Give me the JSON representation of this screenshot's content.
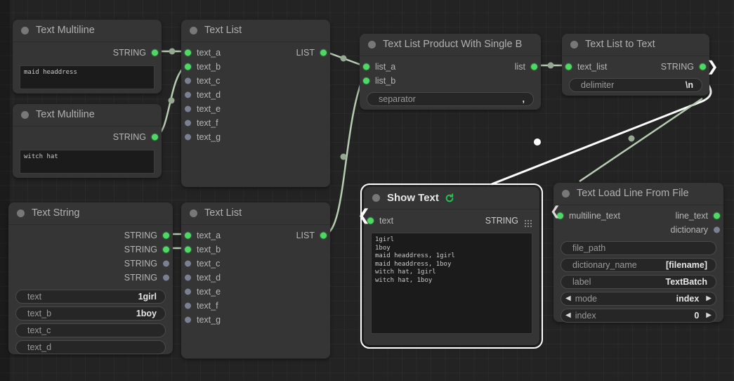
{
  "canvas": {
    "bg_color": "#232323",
    "grid_color": "#2b2b2b"
  },
  "colors": {
    "link_green": "#b8ccb4",
    "link_selected": "#ffffff",
    "slot_connected": "#4cd964",
    "slot_empty": "#7b7f92",
    "node_bg": "#353535",
    "widget_bg": "#262626"
  },
  "nodes": {
    "text_multiline_1": {
      "title": "Text Multiline",
      "output_label": "STRING",
      "value": "maid headdress"
    },
    "text_multiline_2": {
      "title": "Text Multiline",
      "output_label": "STRING",
      "value": "witch hat"
    },
    "text_list_top": {
      "title": "Text List",
      "output_label": "LIST",
      "inputs": [
        "text_a",
        "text_b",
        "text_c",
        "text_d",
        "text_e",
        "text_f",
        "text_g"
      ]
    },
    "text_list_bottom": {
      "title": "Text List",
      "output_label": "LIST",
      "inputs": [
        "text_a",
        "text_b",
        "text_c",
        "text_d",
        "text_e",
        "text_f",
        "text_g"
      ]
    },
    "text_string": {
      "title": "Text String",
      "outputs": [
        "STRING",
        "STRING",
        "STRING",
        "STRING"
      ],
      "widgets": [
        {
          "label": "text",
          "value": "1girl"
        },
        {
          "label": "text_b",
          "value": "1boy"
        },
        {
          "label": "text_c",
          "value": ""
        },
        {
          "label": "text_d",
          "value": ""
        }
      ]
    },
    "text_list_product": {
      "title": "Text List Product With Single B",
      "inputs": [
        "list_a",
        "list_b"
      ],
      "output_label": "list",
      "widget": {
        "label": "separator",
        "value": ","
      }
    },
    "text_list_to_text": {
      "title": "Text List to Text",
      "input_label": "text_list",
      "output_label": "STRING",
      "widget": {
        "label": "delimiter",
        "value": "\\n"
      }
    },
    "show_text": {
      "title": "Show Text",
      "refresh_icon": "refresh-icon",
      "input_label": "text",
      "output_label": "STRING",
      "grid_icon": "grid-dots-icon",
      "content": "1girl\n1boy\nmaid headdress, 1girl\nmaid headdress, 1boy\nwitch hat, 1girl\nwitch hat, 1boy"
    },
    "text_load_line_from_file": {
      "title": "Text Load Line From File",
      "input_label": "multiline_text",
      "outputs": [
        "line_text",
        "dictionary"
      ],
      "widgets": [
        {
          "label": "file_path",
          "value": ""
        },
        {
          "label": "dictionary_name",
          "value": "[filename]"
        },
        {
          "label": "label",
          "value": "TextBatch"
        },
        {
          "label": "mode",
          "value": "index",
          "stepper": true
        },
        {
          "label": "index",
          "value": "0",
          "stepper": true
        }
      ]
    }
  }
}
